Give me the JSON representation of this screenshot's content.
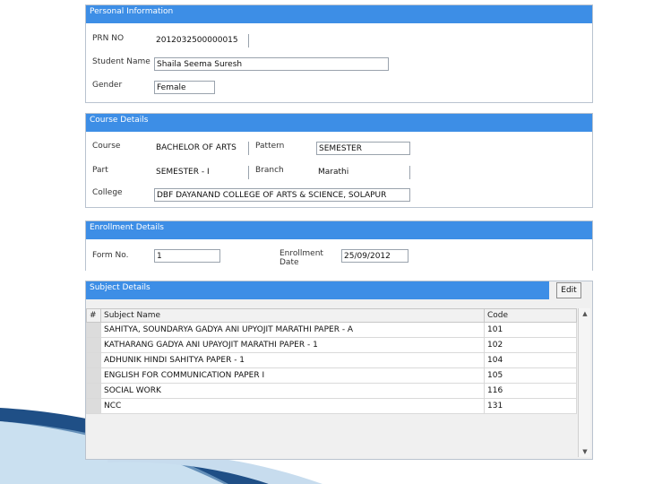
{
  "personal": {
    "header": "Personal Information",
    "prn_label": "PRN NO",
    "prn_value": "2012032500000015",
    "student_label": "Student Name",
    "student_value": "Shaila Seema Suresh",
    "gender_label": "Gender",
    "gender_value": "Female"
  },
  "course": {
    "header": "Course Details",
    "course_label": "Course",
    "course_value": "BACHELOR OF ARTS",
    "pattern_label": "Pattern",
    "pattern_value": "SEMESTER",
    "part_label": "Part",
    "part_value": "SEMESTER - I",
    "branch_label": "Branch",
    "branch_value": "Marathi",
    "college_label": "College",
    "college_value": "DBF DAYANAND COLLEGE OF ARTS & SCIENCE, SOLAPUR"
  },
  "enrollment": {
    "header": "Enrollment Details",
    "form_label": "Form No.",
    "form_value": "1",
    "date_label_1": "Enrollment",
    "date_label_2": "Date",
    "date_value": "25/09/2012"
  },
  "subjects": {
    "header": "Subject Details",
    "edit_label": "Edit",
    "columns": [
      "#",
      "Subject Name",
      "Code"
    ],
    "rows": [
      {
        "name": "SAHITYA, SOUNDARYA GADYA ANI UPYOJIT MARATHI PAPER - A",
        "code": "101"
      },
      {
        "name": "KATHARANG GADYA ANI UPAYOJIT MARATHI PAPER - 1",
        "code": "102"
      },
      {
        "name": "ADHUNIK HINDI SAHITYA PAPER - 1",
        "code": "104"
      },
      {
        "name": "ENGLISH FOR COMMUNICATION PAPER I",
        "code": "105"
      },
      {
        "name": "SOCIAL WORK",
        "code": "116"
      },
      {
        "name": "NCC",
        "code": "131"
      }
    ]
  },
  "colors": {
    "header_bar": "#3d8ee6",
    "deco_dark": "#17375e",
    "deco_light": "#9ec6e4"
  }
}
